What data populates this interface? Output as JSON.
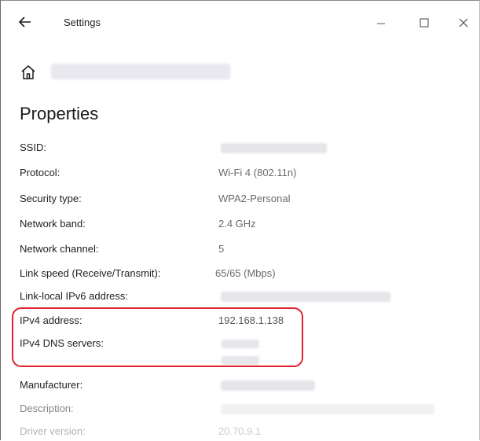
{
  "window": {
    "title": "Settings"
  },
  "page": {
    "heading": "Properties"
  },
  "properties": [
    {
      "label": "SSID:",
      "value": ""
    },
    {
      "label": "Protocol:",
      "value": "Wi-Fi 4 (802.11n)"
    },
    {
      "label": "Security type:",
      "value": "WPA2-Personal"
    },
    {
      "label": "Network band:",
      "value": "2.4 GHz"
    },
    {
      "label": "Network channel:",
      "value": "5"
    },
    {
      "label": "Link speed (Receive/Transmit):",
      "value": "65/65 (Mbps)"
    },
    {
      "label": "Link-local IPv6 address:",
      "value": ""
    },
    {
      "label": "IPv4 address:",
      "value": "192.168.1.138"
    },
    {
      "label": "IPv4 DNS servers:",
      "value": ""
    },
    {
      "label": "Manufacturer:",
      "value": ""
    },
    {
      "label": "Description:",
      "value": ""
    },
    {
      "label": "Driver version:",
      "value": "20.70.9.1"
    }
  ],
  "highlight_color": "#e0222f",
  "icons": [
    "back-arrow-icon",
    "minimize-icon",
    "maximize-icon",
    "close-icon",
    "home-icon"
  ]
}
